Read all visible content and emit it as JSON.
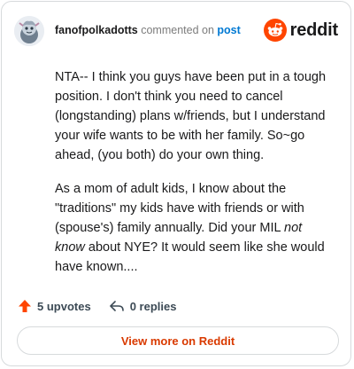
{
  "comment": {
    "username": "fanofpolkadotts",
    "verb": "commented on",
    "target": "post",
    "paragraphs": [
      {
        "text": "NTA-- I think you guys have been put in a tough position. I don't think you need to cancel (longstanding) plans w/friends, but I understand your wife wants to be with her family. So~go ahead, (you both) do your own thing."
      },
      {
        "before_em": "As a mom of adult kids, I know about the \"traditions\" my kids have with friends or with (spouse's) family annually. Did your MIL ",
        "em": "not know",
        "after_em": " about NYE? It would seem like she would have known...."
      }
    ]
  },
  "brand": {
    "name": "reddit",
    "color": "#ff4500"
  },
  "actions": {
    "upvotes": "5 upvotes",
    "replies": "0 replies"
  },
  "view_more_label": "View more on Reddit",
  "colors": {
    "accent": "#d93a00",
    "link": "#0079d3",
    "upvote": "#ff4500"
  }
}
